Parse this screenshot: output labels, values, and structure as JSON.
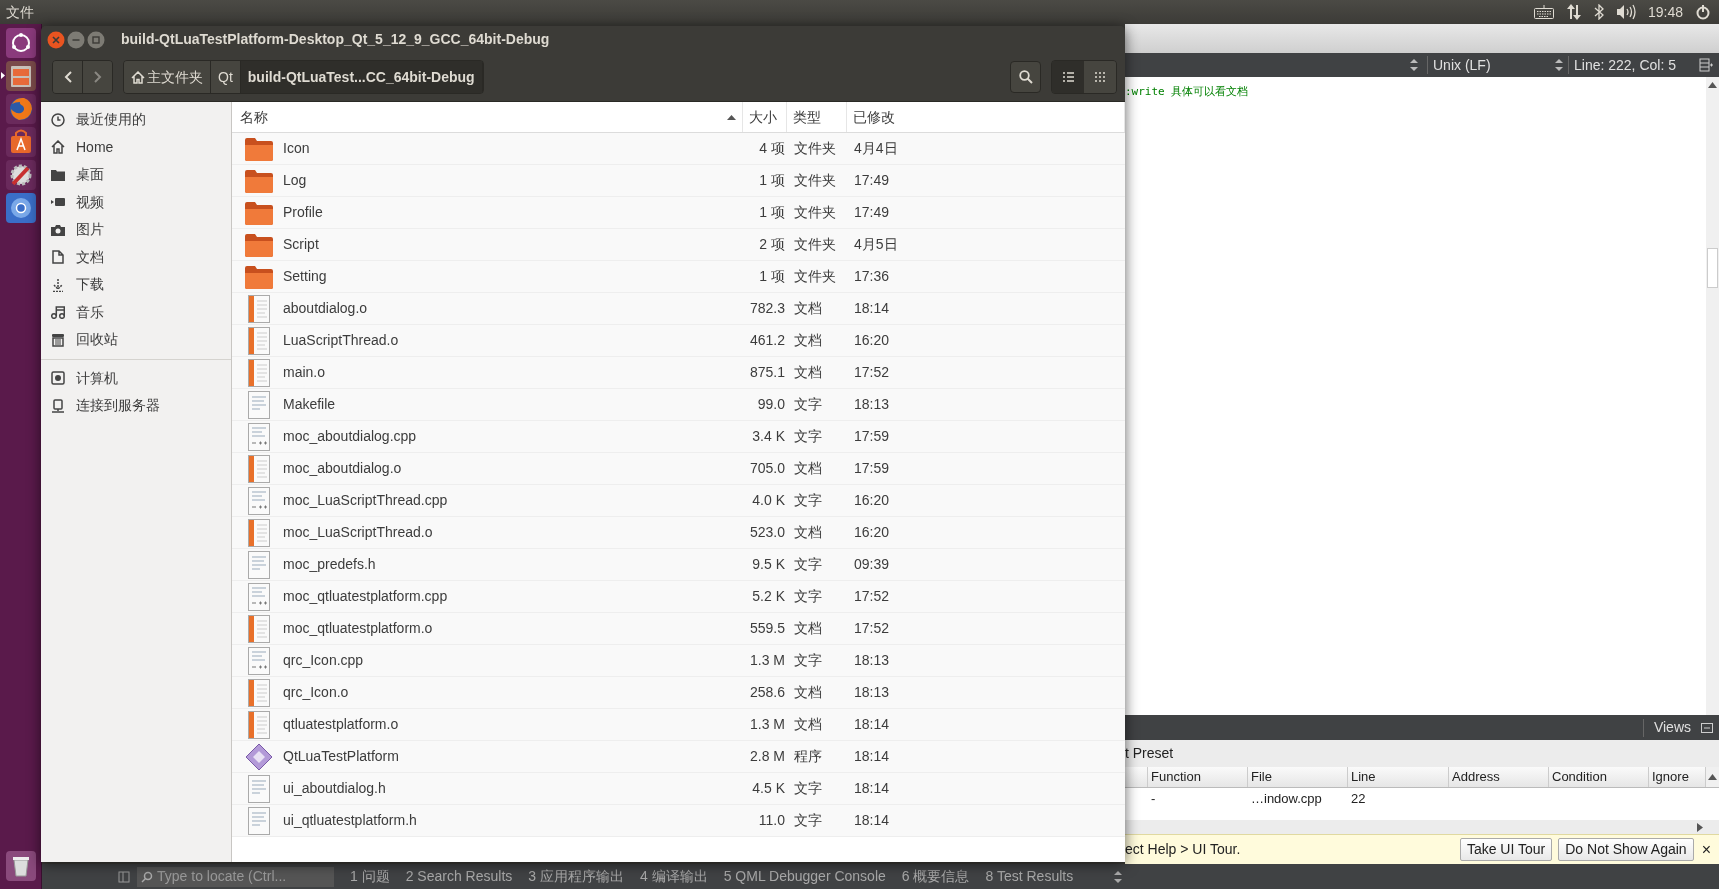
{
  "top_panel": {
    "menu": "文件",
    "clock": "19:48"
  },
  "launcher": {
    "items": [
      {
        "kind": "dash",
        "selected": false
      },
      {
        "kind": "files",
        "selected": true
      },
      {
        "kind": "browser",
        "selected": false
      },
      {
        "kind": "store",
        "selected": false
      },
      {
        "kind": "settings",
        "selected": false
      },
      {
        "kind": "chromium",
        "selected": false
      }
    ]
  },
  "file_manager": {
    "title": "build-QtLuaTestPlatform-Desktop_Qt_5_12_9_GCC_64bit-Debug",
    "path": [
      {
        "label": "主文件夹",
        "kind": "home",
        "selected": false
      },
      {
        "label": "Qt",
        "kind": "folder",
        "selected": false
      },
      {
        "label": "build-QtLuaTest...CC_64bit-Debug",
        "kind": "folder",
        "selected": true
      }
    ],
    "view_buttons": [
      {
        "kind": "list",
        "selected": true
      },
      {
        "kind": "grid",
        "selected": false
      }
    ],
    "sidebar": {
      "places": [
        {
          "label": "最近使用的",
          "kind": "recent"
        },
        {
          "label": "Home",
          "kind": "home"
        },
        {
          "label": "桌面",
          "kind": "desktop"
        },
        {
          "label": "视频",
          "kind": "video"
        },
        {
          "label": "图片",
          "kind": "pictures"
        },
        {
          "label": "文档",
          "kind": "documents"
        },
        {
          "label": "下载",
          "kind": "downloads"
        },
        {
          "label": "音乐",
          "kind": "music"
        },
        {
          "label": "回收站",
          "kind": "trash"
        }
      ],
      "devices": [
        {
          "label": "计算机",
          "kind": "computer"
        },
        {
          "label": "连接到服务器",
          "kind": "server"
        }
      ]
    },
    "columns": [
      {
        "label": "名称",
        "sorted": true
      },
      {
        "label": "大小",
        "sorted": false
      },
      {
        "label": "类型",
        "sorted": false
      },
      {
        "label": "已修改",
        "sorted": false
      }
    ],
    "files": [
      {
        "name": "Icon",
        "size": "4 项",
        "type": "文件夹",
        "modified": "4月4日",
        "kind": "folder"
      },
      {
        "name": "Log",
        "size": "1 项",
        "type": "文件夹",
        "modified": "17:49",
        "kind": "folder"
      },
      {
        "name": "Profile",
        "size": "1 项",
        "type": "文件夹",
        "modified": "17:49",
        "kind": "folder"
      },
      {
        "name": "Script",
        "size": "2 项",
        "type": "文件夹",
        "modified": "4月5日",
        "kind": "folder"
      },
      {
        "name": "Setting",
        "size": "1 项",
        "type": "文件夹",
        "modified": "17:36",
        "kind": "folder"
      },
      {
        "name": "aboutdialog.o",
        "size": "782.3",
        "type": "文档",
        "modified": "18:14",
        "kind": "object"
      },
      {
        "name": "LuaScriptThread.o",
        "size": "461.2",
        "type": "文档",
        "modified": "16:20",
        "kind": "object"
      },
      {
        "name": "main.o",
        "size": "875.1",
        "type": "文档",
        "modified": "17:52",
        "kind": "object"
      },
      {
        "name": "Makefile",
        "size": "99.0",
        "type": "文字",
        "modified": "18:13",
        "kind": "text"
      },
      {
        "name": "moc_aboutdialog.cpp",
        "size": "3.4 K",
        "type": "文字",
        "modified": "17:59",
        "kind": "cpp"
      },
      {
        "name": "moc_aboutdialog.o",
        "size": "705.0",
        "type": "文档",
        "modified": "17:59",
        "kind": "object"
      },
      {
        "name": "moc_LuaScriptThread.cpp",
        "size": "4.0 K",
        "type": "文字",
        "modified": "16:20",
        "kind": "cpp"
      },
      {
        "name": "moc_LuaScriptThread.o",
        "size": "523.0",
        "type": "文档",
        "modified": "16:20",
        "kind": "object"
      },
      {
        "name": "moc_predefs.h",
        "size": "9.5 K",
        "type": "文字",
        "modified": "09:39",
        "kind": "text"
      },
      {
        "name": "moc_qtluatestplatform.cpp",
        "size": "5.2 K",
        "type": "文字",
        "modified": "17:52",
        "kind": "cpp"
      },
      {
        "name": "moc_qtluatestplatform.o",
        "size": "559.5",
        "type": "文档",
        "modified": "17:52",
        "kind": "object"
      },
      {
        "name": "qrc_Icon.cpp",
        "size": "1.3 M",
        "type": "文字",
        "modified": "18:13",
        "kind": "cpp"
      },
      {
        "name": "qrc_Icon.o",
        "size": "258.6",
        "type": "文档",
        "modified": "18:13",
        "kind": "object"
      },
      {
        "name": "qtluatestplatform.o",
        "size": "1.3 M",
        "type": "文档",
        "modified": "18:14",
        "kind": "object"
      },
      {
        "name": "QtLuaTestPlatform",
        "size": "2.8 M",
        "type": "程序",
        "modified": "18:14",
        "kind": "executable"
      },
      {
        "name": "ui_aboutdialog.h",
        "size": "4.5 K",
        "type": "文字",
        "modified": "18:14",
        "kind": "text"
      },
      {
        "name": "ui_qtluatestplatform.h",
        "size": "11.0",
        "type": "文字",
        "modified": "18:14",
        "kind": "text"
      }
    ]
  },
  "creator": {
    "line_ending": "Unix (LF)",
    "position": "Line: 222, Col: 5",
    "editor_line": ":write 具体可以看文档",
    "views_label": "Views",
    "preset_label": "t Preset",
    "breakpoint_columns": [
      "Function",
      "File",
      "Line",
      "Address",
      "Condition",
      "Ignore"
    ],
    "breakpoint_rows": [
      [
        "-",
        "…indow.cpp",
        "22",
        "",
        "",
        ""
      ]
    ],
    "info_text": "ect Help > UI Tour.",
    "info_buttons": [
      "Take UI Tour",
      "Do Not Show Again"
    ],
    "info_close": "×",
    "locator_placeholder": "Type to locate (Ctrl...",
    "output_tabs": [
      "1 问题",
      "2 Search Results",
      "3 应用程序输出",
      "4 编译输出",
      "5 QML Debugger Console",
      "6 概要信息",
      "8 Test Results"
    ]
  }
}
